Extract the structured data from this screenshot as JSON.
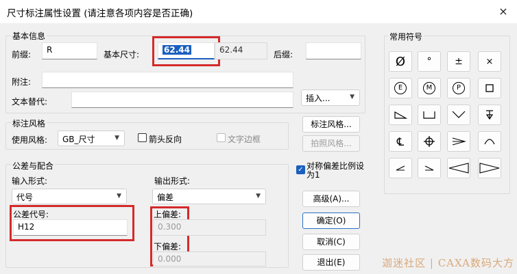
{
  "window": {
    "title": "尺寸标注属性设置 (请注意各项内容是否正确)",
    "close_label": "×"
  },
  "basic_info": {
    "group_title": "基本信息",
    "prefix_label": "前缀:",
    "prefix_value": "R",
    "base_size_label": "基本尺寸:",
    "base_size_value": "62.44",
    "base_size_readonly": "62.44",
    "suffix_label": "后缀:",
    "suffix_value": "",
    "note_label": "附注:",
    "note_value": "",
    "text_replace_label": "文本替代:",
    "text_replace_value": "",
    "insert_label": "插入..."
  },
  "dim_style": {
    "group_title": "标注风格",
    "use_style_label": "使用风格:",
    "use_style_value": "GB_尺寸",
    "arrow_reverse_label": "箭头反向",
    "arrow_reverse_checked": false,
    "text_border_label": "文字边框",
    "text_border_checked": false,
    "style_button": "标注风格...",
    "copy_style_button": "拍照风格..."
  },
  "tolerance": {
    "group_title": "公差与配合",
    "input_form_label": "输入形式:",
    "input_form_value": "代号",
    "output_form_label": "输出形式:",
    "output_form_value": "偏差",
    "tol_code_label": "公差代号:",
    "tol_code_value": "H12",
    "upper_dev_label": "上偏差:",
    "upper_dev_value": "0.300",
    "lower_dev_label": "下偏差:",
    "lower_dev_value": "0.000"
  },
  "symmetric": {
    "label": "对称偏差比例设为1",
    "checked": true
  },
  "buttons": {
    "advanced": "高级(A)...",
    "ok": "确定(O)",
    "cancel": "取消(C)",
    "exit": "退出(E)"
  },
  "symbols": {
    "group_title": "常用符号",
    "items": [
      {
        "name": "diameter-icon",
        "glyph": "Ø"
      },
      {
        "name": "degree-icon",
        "glyph": "°"
      },
      {
        "name": "plus-minus-icon",
        "glyph": "±"
      },
      {
        "name": "multiply-icon",
        "glyph": "×"
      },
      {
        "name": "circled-e-icon",
        "glyph": "E"
      },
      {
        "name": "circled-m-icon",
        "glyph": "M"
      },
      {
        "name": "circled-p-icon",
        "glyph": "P"
      },
      {
        "name": "square-icon",
        "glyph": ""
      },
      {
        "name": "slope-icon",
        "glyph": ""
      },
      {
        "name": "counterbore-icon",
        "glyph": ""
      },
      {
        "name": "countersink-icon",
        "glyph": ""
      },
      {
        "name": "depth-icon",
        "glyph": ""
      },
      {
        "name": "centerline-icon",
        "glyph": "℄"
      },
      {
        "name": "crosshair-icon",
        "glyph": ""
      },
      {
        "name": "taper-icon",
        "glyph": ""
      },
      {
        "name": "arc-icon",
        "glyph": ""
      },
      {
        "name": "angle-left-icon",
        "glyph": ""
      },
      {
        "name": "angle-right-icon",
        "glyph": ""
      },
      {
        "name": "taper-left-icon",
        "glyph": ""
      },
      {
        "name": "taper-right-icon",
        "glyph": ""
      }
    ]
  },
  "watermark": "迦迷社区 | CAXA数码大方"
}
